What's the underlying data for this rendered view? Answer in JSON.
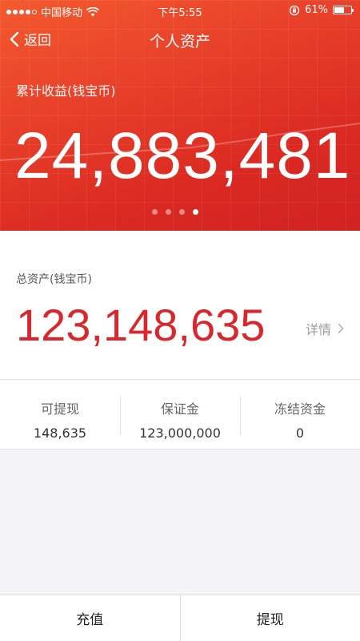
{
  "status_bar": {
    "carrier": "中国移动",
    "time": "下午5:55",
    "battery_text": "61%",
    "battery_level": 0.61
  },
  "nav": {
    "back_label": "返回",
    "title": "个人资产"
  },
  "hero": {
    "earnings_label": "累计收益(钱宝币)",
    "earnings_value": "24,883,481",
    "page_count": 4,
    "active_page": 4
  },
  "assets": {
    "label": "总资产(钱宝币)",
    "value": "123,148,635",
    "detail_label": "详情"
  },
  "stats": [
    {
      "label": "可提现",
      "value": "148,635"
    },
    {
      "label": "保证金",
      "value": "123,000,000"
    },
    {
      "label": "冻结资金",
      "value": "0"
    }
  ],
  "bottom_bar": {
    "recharge_label": "充值",
    "withdraw_label": "提现"
  },
  "colors": {
    "accent_red": "#d9272d",
    "hero_start": "#f45a2e",
    "hero_end": "#d12222"
  }
}
